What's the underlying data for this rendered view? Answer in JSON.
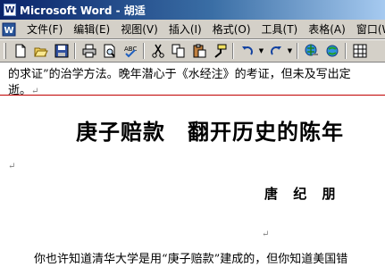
{
  "window": {
    "title": "Microsoft Word - 胡适",
    "app_icon": "W"
  },
  "menubar": {
    "items": [
      {
        "label": "文件(F)"
      },
      {
        "label": "编辑(E)"
      },
      {
        "label": "视图(V)"
      },
      {
        "label": "插入(I)"
      },
      {
        "label": "格式(O)"
      },
      {
        "label": "工具(T)"
      },
      {
        "label": "表格(A)"
      },
      {
        "label": "窗口(W"
      }
    ]
  },
  "toolbar": {
    "buttons": [
      "new-icon",
      "open-icon",
      "save-icon",
      "print-icon",
      "print-preview-icon",
      "spelling-icon",
      "cut-icon",
      "copy-icon",
      "paste-icon",
      "format-painter-icon",
      "undo-icon",
      "redo-icon",
      "hyperlink-icon",
      "web-toolbar-icon",
      "tables-borders-icon"
    ]
  },
  "document": {
    "line1": "的求证”的治学方法。晚年潜心于《水经注》的考证，但未及写出定",
    "line2": "逝。",
    "heading": "庚子赔款　翻开历史的陈年",
    "author": "唐 纪 朋",
    "body": "你也许知道清华大学是用“庚子赔款”建成的，但你知道美国错",
    "para_mark": "↵"
  },
  "colors": {
    "title_start": "#0a246a",
    "title_end": "#a6caf0",
    "redline": "#c00000"
  }
}
